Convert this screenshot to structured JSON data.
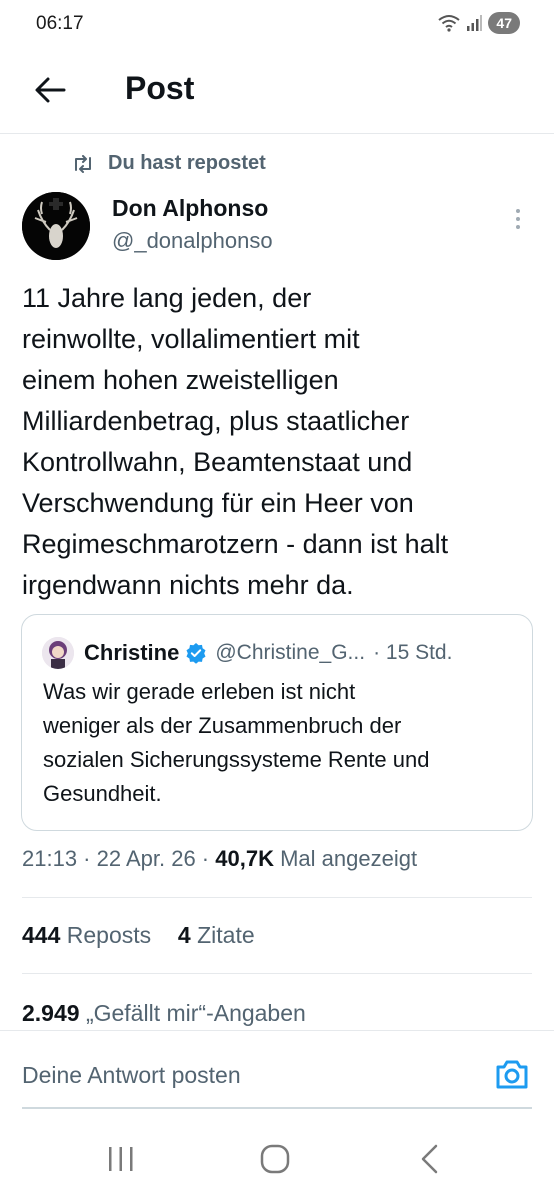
{
  "status_bar": {
    "time": "06:17",
    "battery": "47"
  },
  "header": {
    "title": "Post"
  },
  "repost": {
    "label": "Du hast repostet"
  },
  "author": {
    "name": "Don Alphonso",
    "handle": "@_donalphonso"
  },
  "tweet": {
    "text": "11 Jahre lang jeden, der\nreinwollte, vollalimentiert mit\neinem hohen zweistelligen\nMilliardenbetrag, plus staatlicher\nKontrollwahn, Beamtenstaat und\nVerschwendung für ein Heer von\nRegimeschmarotzern - dann ist halt\nirgendwann nichts mehr da."
  },
  "quote": {
    "name": "Christine",
    "handle": "@Christine_G...",
    "time": "· 15 Std.",
    "text": "Was wir gerade erleben ist nicht\nweniger als der Zusammenbruch der\nsozialen Sicherungssysteme Rente und\nGesundheit."
  },
  "meta": {
    "datetime": "21:13 · 22 Apr. 26 · ",
    "views": "40,7K",
    "views_label": " Mal angezeigt"
  },
  "stats": {
    "reposts": "444",
    "reposts_label": " Reposts",
    "quotes": "4",
    "quotes_label": " Zitate",
    "likes": "2.949",
    "likes_label": " „Gefällt mir“-Angaben"
  },
  "reply": {
    "placeholder": "Deine Antwort posten"
  },
  "colors": {
    "accent": "#1d9bf0",
    "secondary_text": "#536471",
    "primary_text": "#0f1419",
    "border": "#cfd9de"
  },
  "icons": {
    "back": "arrow-left-icon",
    "repost": "repost-icon",
    "more": "more-vertical-icon",
    "verified": "verified-badge-icon",
    "camera": "camera-icon",
    "nav_recent": "recent-apps-icon",
    "nav_home": "home-icon",
    "nav_back": "chevron-left-icon"
  }
}
